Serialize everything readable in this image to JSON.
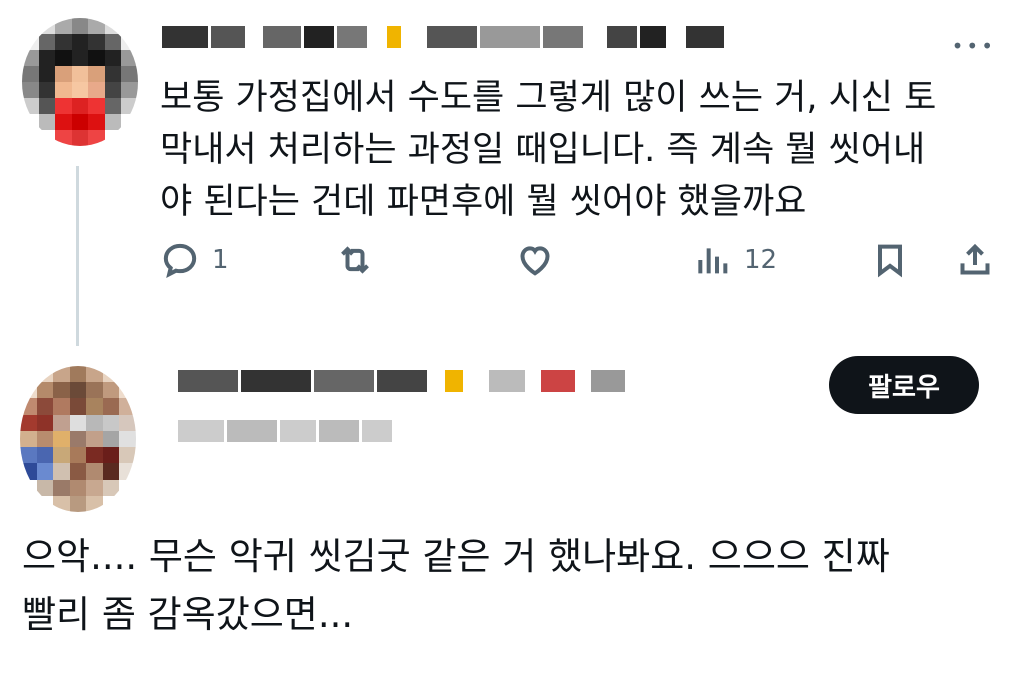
{
  "tweet": {
    "author_name": "",
    "text": "보통 가정집에서 수도를 그렇게 많이 쓰는 거, 시신 토\n막내서 처리하는 과정일 때입니다. 즉 계속 뭘 씻어내\n야 된다는 건데 파면후에 뭘 씻어야 했을까요",
    "more_icon": "ellipsis-icon",
    "actions": {
      "reply_count": "1",
      "retweet_count": "",
      "like_count": "",
      "view_count": "12"
    }
  },
  "reply_user": {
    "name": "",
    "handle": "",
    "follow_label": "팔로우"
  },
  "reply": {
    "text": "으악.... 무슨 악귀 씻김굿 같은 거 했나봐요. 으으으 진짜\n빨리 좀 감옥갔으면..."
  }
}
